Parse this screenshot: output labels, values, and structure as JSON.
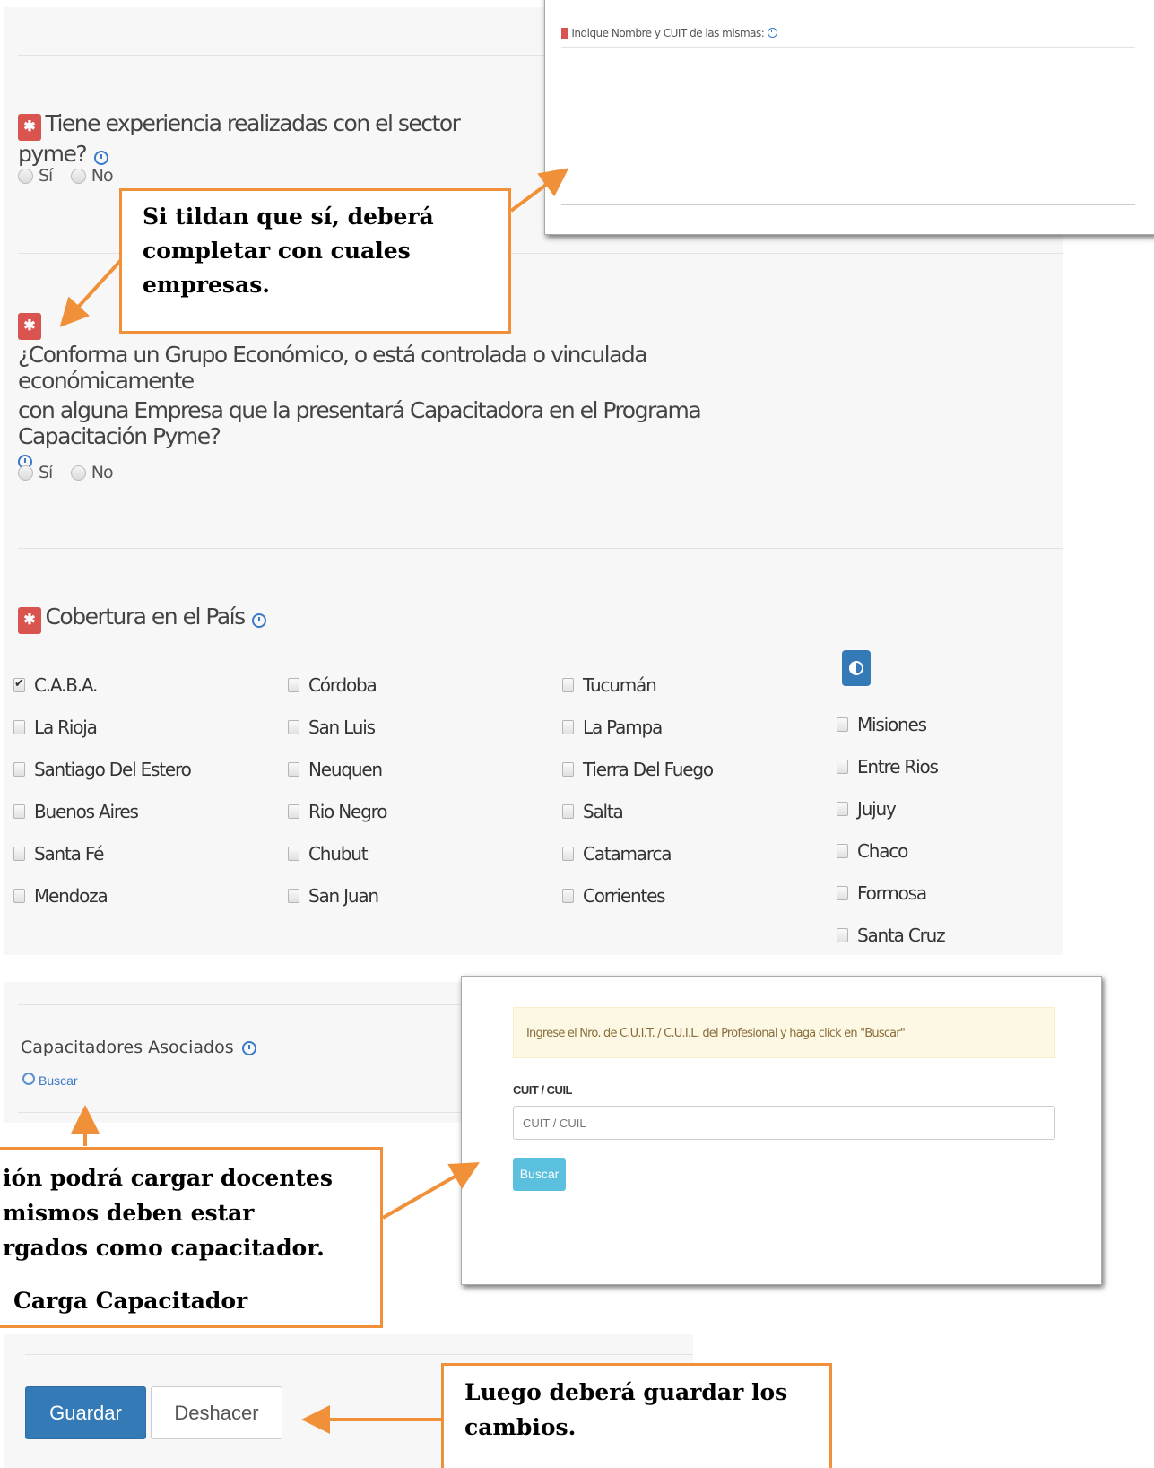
{
  "top_panel": {
    "label": "Indique Nombre y CUIT de las mismas:",
    "clock_icon": "clock-icon"
  },
  "q1": {
    "text": "Tiene experiencia realizadas con el sector pyme?",
    "options": [
      "Sí",
      "No"
    ]
  },
  "q2": {
    "line1": "¿Conforma un Grupo Económico, o está controlada o vinculada económicamente",
    "line2": "con alguna Empresa que la presentará Capacitadora en el Programa Capacitación Pyme?",
    "options": [
      "Sí",
      "No"
    ]
  },
  "coverage": {
    "title": "Cobertura en el País",
    "col1": [
      "C.A.B.A.",
      "La Rioja",
      "Santiago Del Estero",
      "Buenos Aires",
      "Santa Fé",
      "Mendoza"
    ],
    "col2": [
      "Córdoba",
      "San Luis",
      "Neuquen",
      "Rio Negro",
      "Chubut",
      "San Juan"
    ],
    "col3": [
      "Tucumán",
      "La Pampa",
      "Tierra Del Fuego",
      "Salta",
      "Catamarca",
      "Corrientes"
    ],
    "col4": [
      "Misiones",
      "Entre Rios",
      "Jujuy",
      "Chaco",
      "Formosa",
      "Santa Cruz"
    ],
    "checked": [
      "C.A.B.A."
    ]
  },
  "capacitadores": {
    "title": "Capacitadores Asociados",
    "search_link": "Buscar"
  },
  "search_panel": {
    "hint": "Ingrese el Nro. de C.U.I.T. / C.U.I.L. del Profesional y haga click en \"Buscar\"",
    "field_label": "CUIT / CUIL",
    "placeholder": "CUIT / CUIL",
    "button": "Buscar"
  },
  "actions": {
    "save": "Guardar",
    "undo": "Deshacer"
  },
  "callouts": {
    "c1_line1": "Si tildan que sí, deberá",
    "c1_line2": "completar con cuales",
    "c1_line3": "empresas.",
    "c2_line1": "ión podrá cargar docentes",
    "c2_line2": "mismos deben estar",
    "c2_line3": "rgados como capacitador.",
    "c2_line4": "Carga Capacitador",
    "c3_line1": "Luego deberá guardar los",
    "c3_line2": "cambios."
  },
  "colors": {
    "required": "#d9534f",
    "primary": "#337ab7",
    "info": "#5bc0de",
    "callout_border": "#f0913a",
    "hint_bg": "#fcf8e3"
  }
}
